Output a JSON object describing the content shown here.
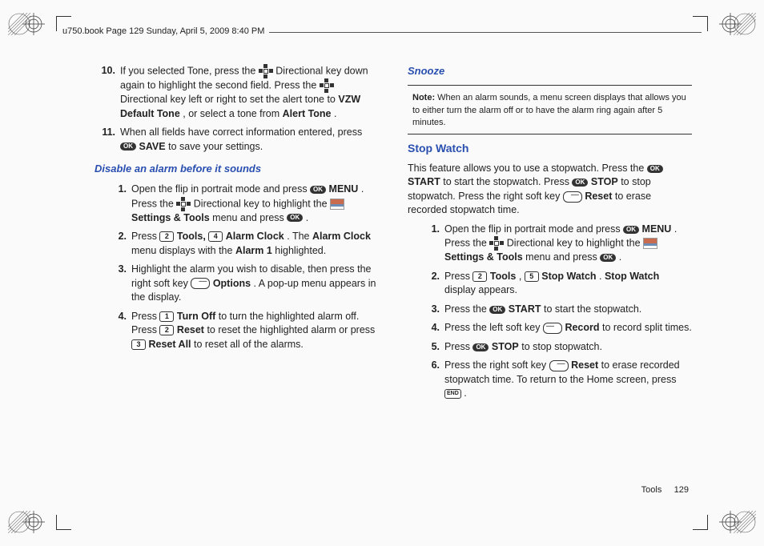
{
  "header": "u750.book  Page 129  Sunday, April 5, 2009  8:40 PM",
  "col1": {
    "step10": {
      "n": "10.",
      "pre": "If you selected Tone, press the ",
      "mid1": " Directional key down again to highlight the second field. Press the ",
      "mid2": " Directional key left or right to set the alert tone to ",
      "vzw": "VZW Default Tone",
      "mid3": ", or select a tone from ",
      "alert": "Alert Tone",
      "end": "."
    },
    "step11": {
      "n": "11.",
      "pre": "When all fields have correct information entered, press ",
      "ok": " ",
      "save": "SAVE",
      "end": " to save your settings."
    },
    "subhead": "Disable an alarm before it sounds",
    "d1": {
      "n": "1.",
      "pre": "Open the flip in portrait mode and press ",
      "menu": "MENU",
      "mid1": ". Press the ",
      "mid2": " Directional key to highlight the ",
      "st": "Settings & Tools",
      "mid3": " menu and press ",
      "end": "."
    },
    "d2": {
      "n": "2.",
      "pre": "Press ",
      "k2": "2",
      "tools": "Tools,",
      "k4": "4",
      "ac": "Alarm Clock",
      "mid": ". The ",
      "ac2": "Alarm Clock",
      "mid2": " menu displays with the ",
      "a1": "Alarm 1",
      "end": " highlighted."
    },
    "d3": {
      "n": "3.",
      "pre": "Highlight the alarm you wish to disable, then press the right soft key ",
      "opt": "Options",
      "end": ". A pop-up menu appears in the display."
    },
    "d4": {
      "n": "4.",
      "pre": "Press ",
      "k1": "1",
      "to": "Turn Off",
      "mid1": " to turn the highlighted alarm off. Press ",
      "k2": "2",
      "reset": "Reset",
      "mid2": " to reset the highlighted alarm or press ",
      "k3": "3",
      "ra": "Reset All",
      "end": " to reset all of the alarms."
    }
  },
  "col2": {
    "sec1": "Snooze",
    "note": {
      "lbl": "Note:",
      "txt": " When an alarm sounds, a menu screen displays that allows you to either turn the alarm off or to have the alarm ring again after 5 minutes."
    },
    "sec2": "Stop Watch",
    "intro": {
      "pre": "This feature allows you to use a stopwatch. Press the ",
      "start": "START",
      "mid1": " to start the stopwatch. Press ",
      "stop": "STOP",
      "mid2": " to stop stopwatch. Press the right soft key ",
      "reset": "Reset",
      "end": " to erase recorded stopwatch time."
    },
    "s1": {
      "n": "1.",
      "pre": "Open the flip in portrait mode and press ",
      "menu": "MENU",
      "mid1": ". Press the ",
      "mid2": " Directional key to highlight the ",
      "st": "Settings & Tools",
      "mid3": " menu and press ",
      "end": "."
    },
    "s2": {
      "n": "2.",
      "pre": "Press ",
      "k2": "2",
      "tools": "Tools",
      "comma": ", ",
      "k5": "5",
      "sw": "Stop Watch",
      "mid": ". ",
      "sw2": "Stop Watch",
      "end": " display appears."
    },
    "s3": {
      "n": "3.",
      "pre": "Press the ",
      "start": "START",
      "end": " to start the stopwatch."
    },
    "s4": {
      "n": "4.",
      "pre": "Press the left soft key ",
      "rec": "Record",
      "end": " to record split times."
    },
    "s5": {
      "n": "5.",
      "pre": "Press ",
      "stop": "STOP",
      "end": " to stop stopwatch."
    },
    "s6": {
      "n": "6.",
      "pre": "Press the right soft key ",
      "reset": "Reset",
      "mid": " to erase recorded stopwatch time. To return to the Home screen, press ",
      "endkey": "END",
      "end": "."
    }
  },
  "footer": {
    "label": "Tools",
    "page": "129"
  }
}
